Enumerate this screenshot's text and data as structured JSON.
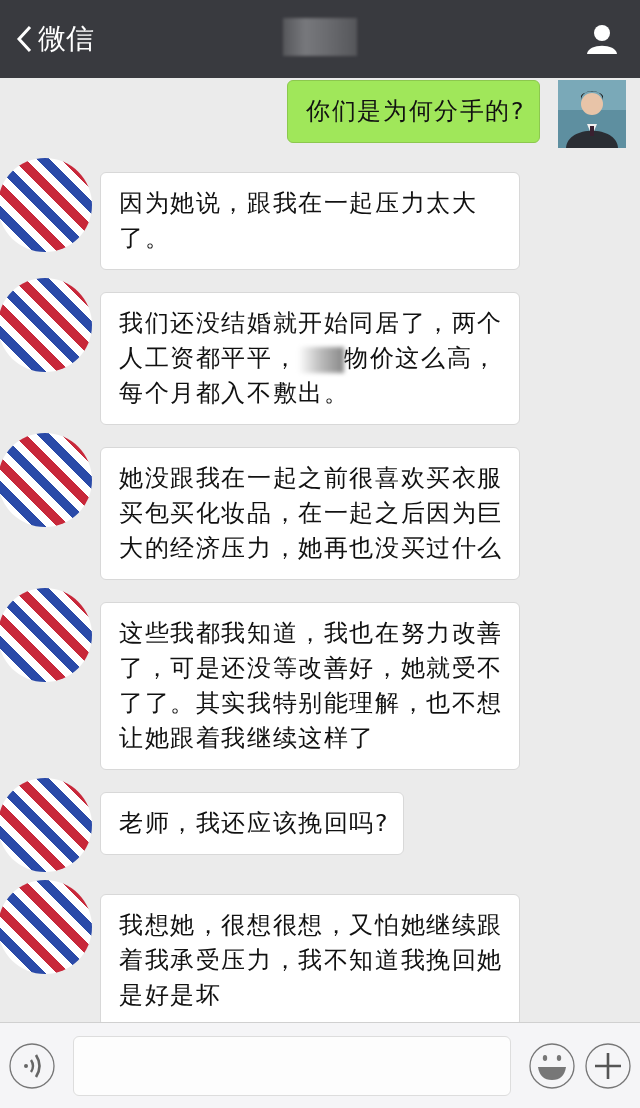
{
  "header": {
    "back_label": "微信"
  },
  "messages": [
    {
      "kind": "sent",
      "parts": [
        "你们是为何分手的?"
      ]
    },
    {
      "kind": "received",
      "parts": [
        "因为她说，跟我在一起压力太大了。"
      ]
    },
    {
      "kind": "received",
      "parts": [
        "我们还没结婚就开始同居了，两个人工资都平平，",
        "物价这么高，每个月都入不敷出。"
      ]
    },
    {
      "kind": "received",
      "parts": [
        "她没跟我在一起之前很喜欢买衣服买包买化妆品，在一起之后因为巨大的经济压力，她再也没买过什么"
      ]
    },
    {
      "kind": "received",
      "parts": [
        "这些我都我知道，我也在努力改善了，可是还没等改善好，她就受不了了。其实我特别能理解，也不想让她跟着我继续这样了"
      ]
    },
    {
      "kind": "received",
      "parts": [
        "老师，我还应该挽回吗?"
      ]
    },
    {
      "kind": "received",
      "parts": [
        "我想她，很想很想，又怕她继续跟着我承受压力，我不知道我挽回她是好是坏"
      ]
    }
  ]
}
